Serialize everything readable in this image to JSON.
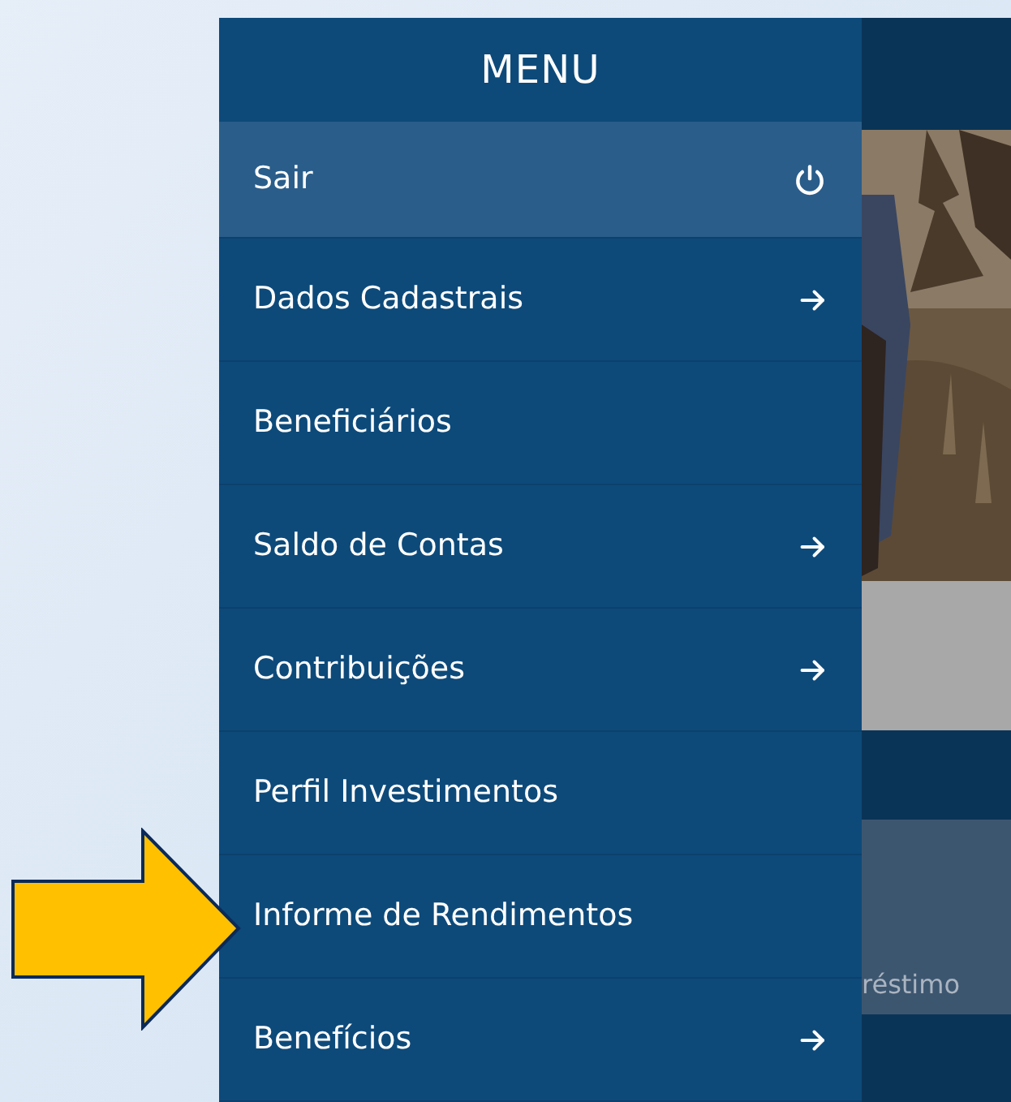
{
  "menu": {
    "title": "MENU",
    "items": [
      {
        "label": "Sair",
        "kind": "action",
        "selected": true
      },
      {
        "label": "Dados Cadastrais",
        "kind": "submenu",
        "selected": false
      },
      {
        "label": "Beneficiários",
        "kind": "link",
        "selected": false
      },
      {
        "label": "Saldo de Contas",
        "kind": "submenu",
        "selected": false
      },
      {
        "label": "Contribuições",
        "kind": "submenu",
        "selected": false
      },
      {
        "label": "Perfil Investimentos",
        "kind": "link",
        "selected": false
      },
      {
        "label": "Informe de Rendimentos",
        "kind": "link",
        "selected": false
      },
      {
        "label": "Benefícios",
        "kind": "submenu",
        "selected": false
      }
    ]
  },
  "background_card": {
    "text": "réstimo"
  },
  "callout": {
    "kind": "arrow"
  }
}
